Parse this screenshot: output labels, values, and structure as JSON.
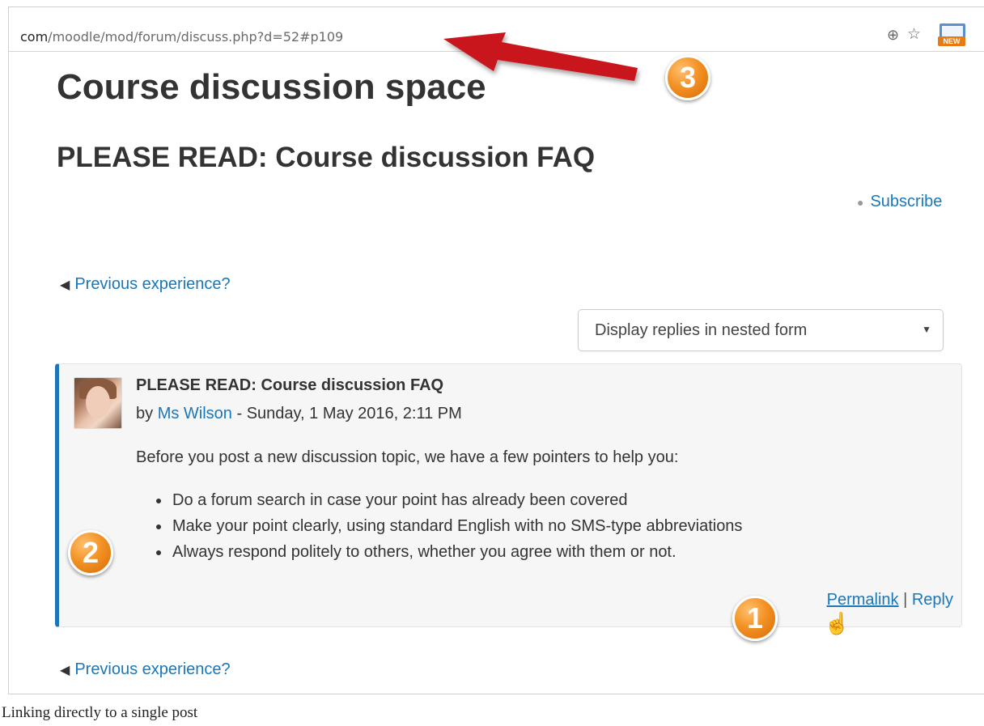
{
  "browser": {
    "url_domain": "com",
    "url_path": "/moodle/mod/forum/discuss.php?d=52#p109"
  },
  "page": {
    "title": "Course discussion space",
    "discussion_title": "PLEASE READ: Course discussion FAQ",
    "subscribe_label": "Subscribe",
    "prev_link": "Previous experience?",
    "display_mode": "Display replies in nested form"
  },
  "post": {
    "subject": "PLEASE READ: Course discussion FAQ",
    "by_prefix": "by",
    "author": "Ms Wilson",
    "date": " - Sunday, 1 May 2016, 2:11 PM",
    "intro": "Before you post a new discussion topic, we have a few pointers to help you:",
    "items": [
      "Do a forum search in case your point has already been covered",
      "Make your point clearly, using standard English with no SMS-type abbreviations",
      "Always respond politely to others, whether you agree with them or not."
    ],
    "permalink": "Permalink",
    "separator": "|",
    "reply": "Reply"
  },
  "badges": {
    "one": "1",
    "two": "2",
    "three": "3"
  },
  "caption": "Linking directly to a single post",
  "icons": [
    "zoom-icon",
    "star-icon",
    "new-screen-icon",
    "hand-cursor-icon",
    "arrow-annotation"
  ],
  "colors": {
    "link": "#1b77b7",
    "badge": "#f39224",
    "arrow": "#c8141a"
  }
}
